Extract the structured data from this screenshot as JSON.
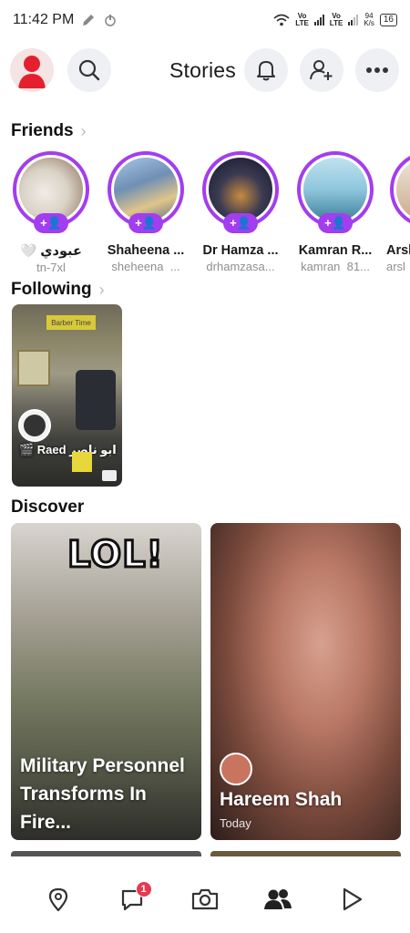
{
  "status_bar": {
    "time": "11:42 PM",
    "net1": "Vo\nLTE",
    "net2": "Vo\nLTE",
    "speed": "94\nK/s",
    "battery": "16"
  },
  "header": {
    "title": "Stories"
  },
  "friends": {
    "title": "Friends",
    "items": [
      {
        "name": "🤍 عبودي",
        "username": "tn-7xl"
      },
      {
        "name": "Shaheena ...",
        "username": "sheheena_..."
      },
      {
        "name": "Dr Hamza ...",
        "username": "drhamzasa..."
      },
      {
        "name": "Kamran R...",
        "username": "kamran_81..."
      },
      {
        "name": "Arsl",
        "username": "arsl"
      }
    ]
  },
  "following": {
    "title": "Following",
    "card_label": "🎬 Raed ابو ناصر",
    "sign_text": "Barber Time"
  },
  "discover": {
    "title": "Discover",
    "cards": [
      {
        "overlay": "LOL!",
        "title": "Military Personnel Transforms In Fire..."
      },
      {
        "publisher": "Hareem Shah",
        "time": "Today"
      }
    ]
  },
  "bottom_nav": {
    "chat_badge": "1"
  },
  "colors": {
    "accent_purple": "#a33df0",
    "badge_red": "#e8384f",
    "button_bg": "#eef0f3"
  }
}
